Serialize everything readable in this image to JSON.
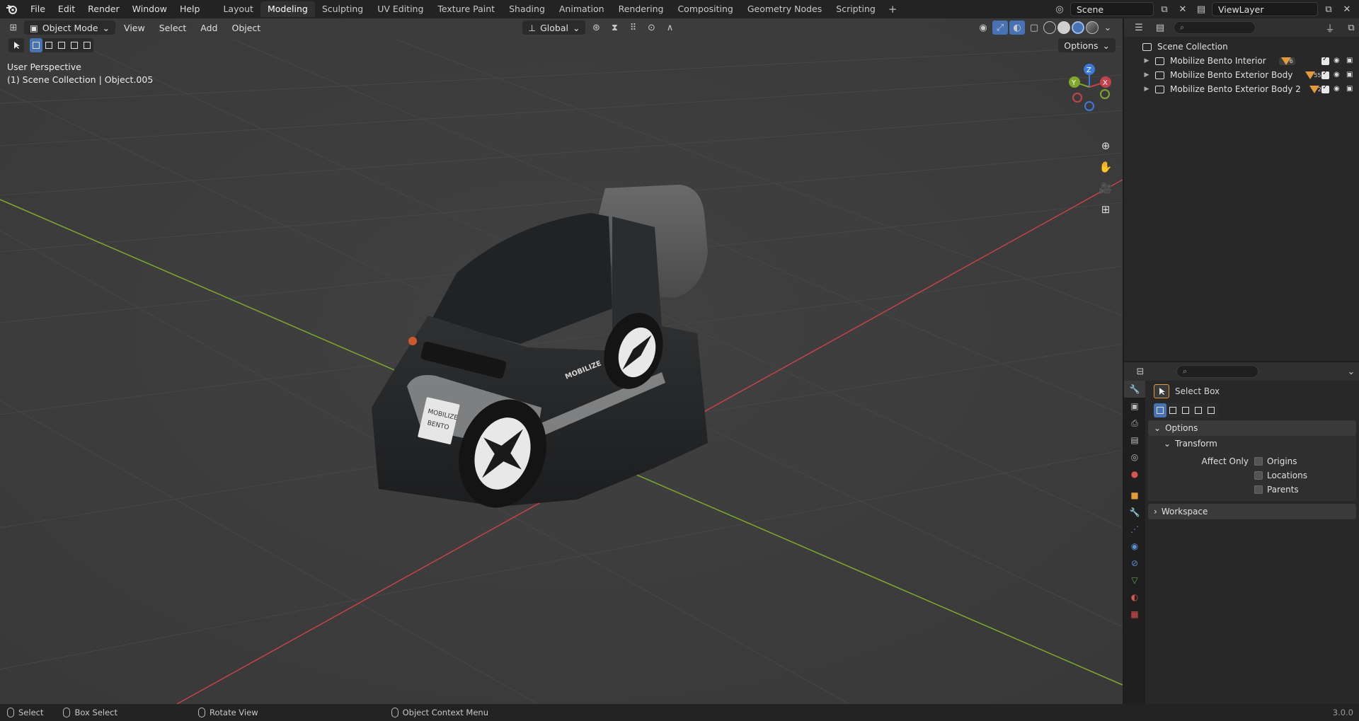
{
  "topbar": {
    "menus": [
      "File",
      "Edit",
      "Render",
      "Window",
      "Help"
    ],
    "workspaces": [
      "Layout",
      "Modeling",
      "Sculpting",
      "UV Editing",
      "Texture Paint",
      "Shading",
      "Animation",
      "Rendering",
      "Compositing",
      "Geometry Nodes",
      "Scripting"
    ],
    "active_workspace": "Modeling",
    "add_label": "+",
    "scene": "Scene",
    "view_layer": "ViewLayer"
  },
  "viewport": {
    "mode": "Object Mode",
    "menus": [
      "View",
      "Select",
      "Add",
      "Object"
    ],
    "orientation": "Global",
    "options_label": "Options",
    "info_line1": "User Perspective",
    "info_line2": "(1) Scene Collection | Object.005",
    "gizmo": {
      "x": "X",
      "y": "Y",
      "z": "Z"
    },
    "car_badge_line1": "MOBILIZE",
    "car_badge_line2": "BENTO",
    "car_side_text": "MOBILIZE"
  },
  "outliner": {
    "root": "Scene Collection",
    "items": [
      {
        "name": "Mobilize Bento Interior",
        "count": "6"
      },
      {
        "name": "Mobilize Bento Exterior Body",
        "count": "55"
      },
      {
        "name": "Mobilize Bento Exterior Body 2",
        "count": "24"
      }
    ]
  },
  "properties": {
    "tool_name": "Select Box",
    "options_label": "Options",
    "transform_label": "Transform",
    "affect_only_label": "Affect Only",
    "checkboxes": [
      "Origins",
      "Locations",
      "Parents"
    ],
    "workspace_label": "Workspace"
  },
  "statusbar": {
    "select": "Select",
    "box_select": "Box Select",
    "rotate_view": "Rotate View",
    "context_menu": "Object Context Menu",
    "version": "3.0.0"
  },
  "colors": {
    "accent": "#4772b3",
    "x_axis": "#c4424a",
    "y_axis": "#7fa82c",
    "z_axis": "#3b7ad9"
  }
}
